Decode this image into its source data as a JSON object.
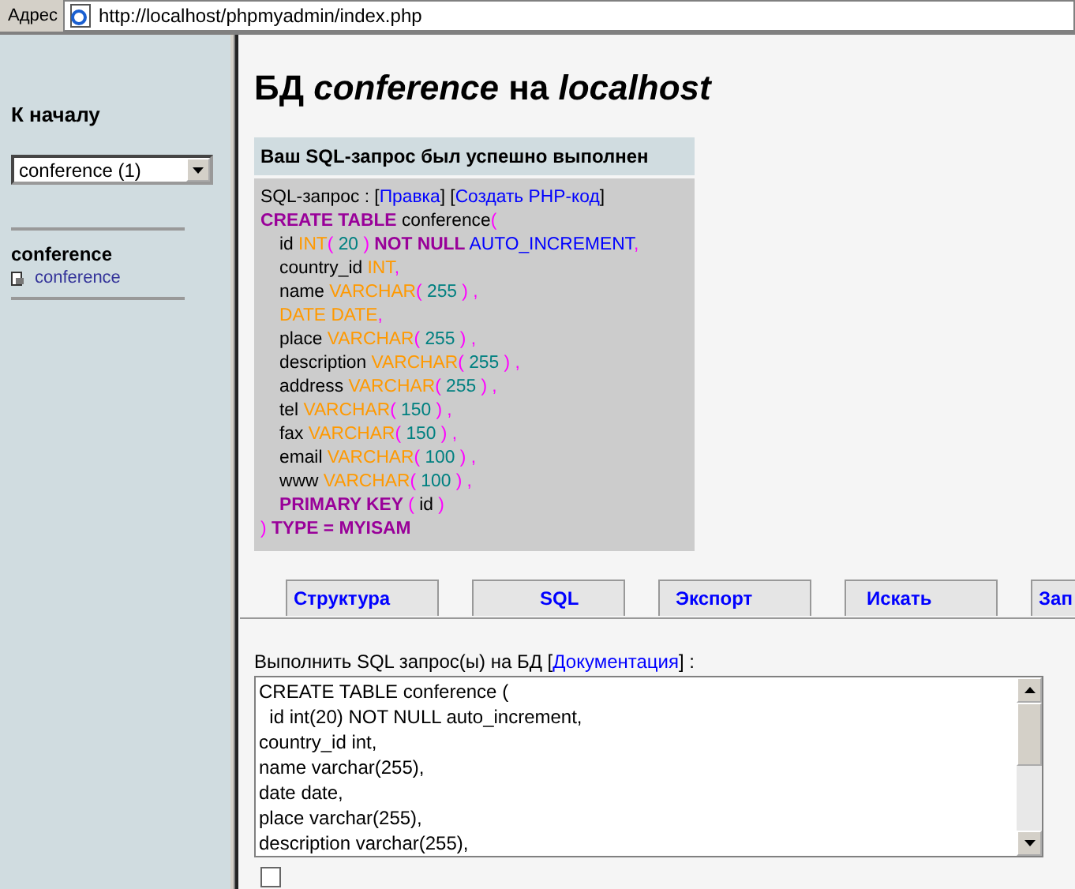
{
  "address_bar": {
    "label": "Адрес",
    "url": "http://localhost/phpmyadmin/index.php"
  },
  "sidebar": {
    "home_link": "К началу",
    "db_select": "conference (1)",
    "db_name": "conference",
    "tables": [
      "conference"
    ]
  },
  "page_title": "БД *conference* на *localhost*",
  "message": {
    "title": "Ваш SQL-запрос был успешно выполнен",
    "query_parts": [
      {
        "kind": "text",
        "text": "SQL-запрос : ["
      },
      {
        "kind": "link",
        "text": "Правка"
      },
      {
        "kind": "text",
        "text": "] ["
      },
      {
        "kind": "link",
        "text": "Создать PHP-код"
      },
      {
        "kind": "text",
        "text": "]"
      }
    ],
    "sql_lines": [
      {
        "indented": false,
        "tokens": [
          {
            "kind": "keyword",
            "text": "CREATE TABLE"
          },
          {
            "kind": "plain",
            "text": " conference"
          },
          {
            "kind": "punct",
            "text": "("
          }
        ]
      },
      {
        "indented": true,
        "tokens": [
          {
            "kind": "plain",
            "text": "id "
          },
          {
            "kind": "type",
            "text": "INT"
          },
          {
            "kind": "punct",
            "text": "("
          },
          {
            "kind": "number",
            "text": " 20 "
          },
          {
            "kind": "punct",
            "text": ")"
          },
          {
            "kind": "keyword",
            "text": " NOT NULL"
          },
          {
            "kind": "func",
            "text": " AUTO_INCREMENT"
          },
          {
            "kind": "punct",
            "text": ","
          }
        ]
      },
      {
        "indented": true,
        "tokens": [
          {
            "kind": "plain",
            "text": "country_id "
          },
          {
            "kind": "type",
            "text": "INT"
          },
          {
            "kind": "punct",
            "text": ","
          }
        ]
      },
      {
        "indented": true,
        "tokens": [
          {
            "kind": "plain",
            "text": "name "
          },
          {
            "kind": "type",
            "text": "VARCHAR"
          },
          {
            "kind": "punct",
            "text": "("
          },
          {
            "kind": "number",
            "text": " 255 "
          },
          {
            "kind": "punct",
            "text": ") ,"
          }
        ]
      },
      {
        "indented": true,
        "tokens": [
          {
            "kind": "type",
            "text": "DATE DATE"
          },
          {
            "kind": "punct",
            "text": ","
          }
        ]
      },
      {
        "indented": true,
        "tokens": [
          {
            "kind": "plain",
            "text": "place "
          },
          {
            "kind": "type",
            "text": "VARCHAR"
          },
          {
            "kind": "punct",
            "text": "("
          },
          {
            "kind": "number",
            "text": " 255 "
          },
          {
            "kind": "punct",
            "text": ") ,"
          }
        ]
      },
      {
        "indented": true,
        "tokens": [
          {
            "kind": "plain",
            "text": "description "
          },
          {
            "kind": "type",
            "text": "VARCHAR"
          },
          {
            "kind": "punct",
            "text": "("
          },
          {
            "kind": "number",
            "text": " 255 "
          },
          {
            "kind": "punct",
            "text": ") ,"
          }
        ]
      },
      {
        "indented": true,
        "tokens": [
          {
            "kind": "plain",
            "text": "address "
          },
          {
            "kind": "type",
            "text": "VARCHAR"
          },
          {
            "kind": "punct",
            "text": "("
          },
          {
            "kind": "number",
            "text": " 255 "
          },
          {
            "kind": "punct",
            "text": ") ,"
          }
        ]
      },
      {
        "indented": true,
        "tokens": [
          {
            "kind": "plain",
            "text": "tel "
          },
          {
            "kind": "type",
            "text": "VARCHAR"
          },
          {
            "kind": "punct",
            "text": "("
          },
          {
            "kind": "number",
            "text": " 150 "
          },
          {
            "kind": "punct",
            "text": ") ,"
          }
        ]
      },
      {
        "indented": true,
        "tokens": [
          {
            "kind": "plain",
            "text": "fax "
          },
          {
            "kind": "type",
            "text": "VARCHAR"
          },
          {
            "kind": "punct",
            "text": "("
          },
          {
            "kind": "number",
            "text": " 150 "
          },
          {
            "kind": "punct",
            "text": ") ,"
          }
        ]
      },
      {
        "indented": true,
        "tokens": [
          {
            "kind": "plain",
            "text": "email "
          },
          {
            "kind": "type",
            "text": "VARCHAR"
          },
          {
            "kind": "punct",
            "text": "("
          },
          {
            "kind": "number",
            "text": " 100 "
          },
          {
            "kind": "punct",
            "text": ") ,"
          }
        ]
      },
      {
        "indented": true,
        "tokens": [
          {
            "kind": "plain",
            "text": "www "
          },
          {
            "kind": "type",
            "text": "VARCHAR"
          },
          {
            "kind": "punct",
            "text": "("
          },
          {
            "kind": "number",
            "text": " 100 "
          },
          {
            "kind": "punct",
            "text": ") ,"
          }
        ]
      },
      {
        "indented": true,
        "tokens": [
          {
            "kind": "keyword",
            "text": "PRIMARY KEY"
          },
          {
            "kind": "punct",
            "text": " ( "
          },
          {
            "kind": "plain",
            "text": "id"
          },
          {
            "kind": "punct",
            "text": " )"
          }
        ]
      },
      {
        "indented": false,
        "tokens": [
          {
            "kind": "punct",
            "text": ") "
          },
          {
            "kind": "keyword",
            "text": "TYPE = MYISAM"
          }
        ]
      }
    ]
  },
  "tabs": [
    {
      "label": "Структура",
      "selected": false
    },
    {
      "label": "SQL",
      "selected": false
    },
    {
      "label": "Экспорт",
      "selected": false
    },
    {
      "label": "Искать",
      "selected": false
    },
    {
      "label": "Зап",
      "selected": false
    }
  ],
  "query_form": {
    "label": "Выполнить SQL запрос(ы) на БД [",
    "doc_link": "Документация",
    "label_end": "] :",
    "value": "CREATE TABLE conference (\n  id int(20) NOT NULL auto_increment,\ncountry_id int,\nname varchar(255),\ndate date,\nplace varchar(255),\ndescription varchar(255),",
    "checkbox": {
      "checked": false
    }
  }
}
